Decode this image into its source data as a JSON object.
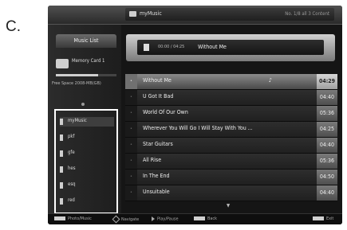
{
  "figure_label": "C.",
  "topbar": {
    "left_title": "",
    "path": "myMusic",
    "meta": "No. 1/8  all 3 Content"
  },
  "sidebar": {
    "tab_label": "Music List",
    "card_label": "Memory Card 1",
    "storage_fraction": 0.7,
    "storage_text": "Free Space 2008-MB(GB)",
    "folders": [
      {
        "label": "myMusic",
        "selected": true
      },
      {
        "label": "pkf",
        "selected": false
      },
      {
        "label": "gfe",
        "selected": false
      },
      {
        "label": "hes",
        "selected": false
      },
      {
        "label": "esq",
        "selected": false
      },
      {
        "label": "red",
        "selected": false
      }
    ]
  },
  "now_playing": {
    "time": "00:00 / 04:25",
    "title": "Without Me"
  },
  "tracks": [
    {
      "title": "Without Me",
      "marker": "♪",
      "duration": "04:29",
      "selected": true
    },
    {
      "title": "U Got It Bad",
      "marker": "",
      "duration": "04:40",
      "selected": false
    },
    {
      "title": "World Of Our Own",
      "marker": "",
      "duration": "05:36",
      "selected": false
    },
    {
      "title": "Wherever You Will Go I Will Stay With You ...",
      "marker": "",
      "duration": "04:25",
      "selected": false
    },
    {
      "title": "Star Guitars",
      "marker": "",
      "duration": "04:40",
      "selected": false
    },
    {
      "title": "All Rise",
      "marker": "",
      "duration": "05:36",
      "selected": false
    },
    {
      "title": "In The End",
      "marker": "",
      "duration": "04:50",
      "selected": false
    },
    {
      "title": "Unsuitable",
      "marker": "",
      "duration": "04:40",
      "selected": false
    }
  ],
  "scroll_indicator": "▼",
  "bottombar": {
    "photo_music": "Photo/Music",
    "navigate": "Navigate",
    "play_note": "Play/Pause",
    "back": "Back",
    "exit": "Exit"
  },
  "colors": {
    "screen_bg": "#151515",
    "selected_row": "#8a8a8a",
    "highlight_border": "#ffffff"
  }
}
